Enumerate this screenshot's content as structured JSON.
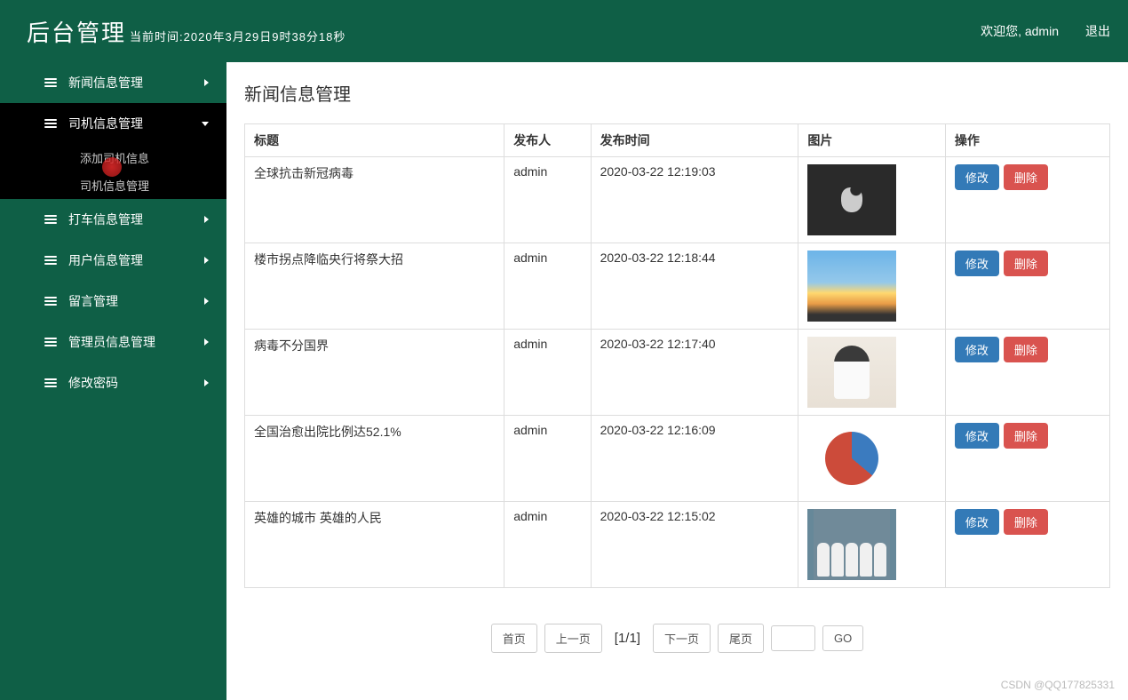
{
  "header": {
    "title": "后台管理",
    "time_label": "当前时间:2020年3月29日9时38分18秒",
    "welcome": "欢迎您, admin",
    "logout": "退出"
  },
  "sidebar": {
    "items": [
      {
        "label": "新闻信息管理",
        "expanded": false
      },
      {
        "label": "司机信息管理",
        "expanded": true
      },
      {
        "label": "打车信息管理",
        "expanded": false
      },
      {
        "label": "用户信息管理",
        "expanded": false
      },
      {
        "label": "留言管理",
        "expanded": false
      },
      {
        "label": "管理员信息管理",
        "expanded": false
      },
      {
        "label": "修改密码",
        "expanded": false
      }
    ],
    "submenu": [
      {
        "label": "添加司机信息"
      },
      {
        "label": "司机信息管理"
      }
    ]
  },
  "page": {
    "title": "新闻信息管理"
  },
  "table": {
    "headers": {
      "title": "标题",
      "publisher": "发布人",
      "time": "发布时间",
      "image": "图片",
      "action": "操作"
    },
    "actions": {
      "edit": "修改",
      "delete": "删除"
    },
    "rows": [
      {
        "title": "全球抗击新冠病毒",
        "publisher": "admin",
        "time": "2020-03-22 12:19:03",
        "thumb": "thumb-1"
      },
      {
        "title": "楼市拐点降临央行将祭大招",
        "publisher": "admin",
        "time": "2020-03-22 12:18:44",
        "thumb": "thumb-2"
      },
      {
        "title": "病毒不分国界",
        "publisher": "admin",
        "time": "2020-03-22 12:17:40",
        "thumb": "thumb-3"
      },
      {
        "title": "全国治愈出院比例达52.1%",
        "publisher": "admin",
        "time": "2020-03-22 12:16:09",
        "thumb": "thumb-4"
      },
      {
        "title": "英雄的城市 英雄的人民",
        "publisher": "admin",
        "time": "2020-03-22 12:15:02",
        "thumb": "thumb-5"
      }
    ]
  },
  "pagination": {
    "first": "首页",
    "prev": "上一页",
    "info": "[1/1]",
    "next": "下一页",
    "last": "尾页",
    "go": "GO"
  },
  "watermark": "CSDN @QQ177825331"
}
